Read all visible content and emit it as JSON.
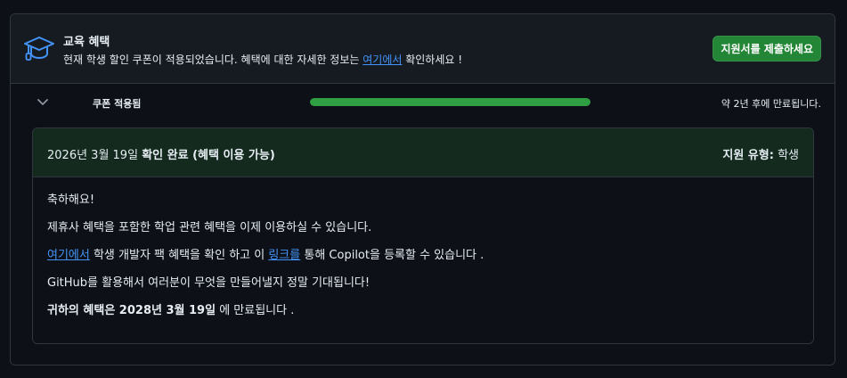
{
  "header": {
    "title": "교육 혜택",
    "desc_before": "현재 학생 할인 쿠폰이 적용되었습니다. 혜택에 대한 자세한 정보는 ",
    "desc_link": "여기에서",
    "desc_after": " 확인하세요 !",
    "icon": "graduation-cap-icon"
  },
  "apply_button": {
    "label": "지원서를 제출하세요"
  },
  "coupon": {
    "label": "쿠폰 적용됨",
    "progress_fraction": 1.0,
    "expire_text": "약 2년 후에 만료됩니다."
  },
  "status": {
    "date": "2026년 3월 19일",
    "confirm": "확인 완료 (혜택 이용 가능)",
    "type_label": "지원 유형:",
    "type_value": "학생"
  },
  "body": {
    "line1": "축하해요!",
    "line2": "제휴사 혜택을 포함한 학업 관련 혜택을 이제 이용하실 수 있습니다.",
    "line3_link1": "여기에서",
    "line3_mid": " 학생 개발자 팩 혜택을 확인 하고 이 ",
    "line3_link2": "링크를",
    "line3_end": " 통해 Copilot을 등록할 수 있습니다 .",
    "line4": "GitHub를 활용해서 여러분이 무엇을 만들어낼지 정말 기대됩니다!",
    "line5_strong": "귀하의 혜택은 2028년 3월 19일",
    "line5_end": " 에 만료됩니다 ."
  },
  "colors": {
    "accent_green": "#238636",
    "progress_green": "#2ea043",
    "link_blue": "#4493f8",
    "status_bg": "#142a1f"
  }
}
